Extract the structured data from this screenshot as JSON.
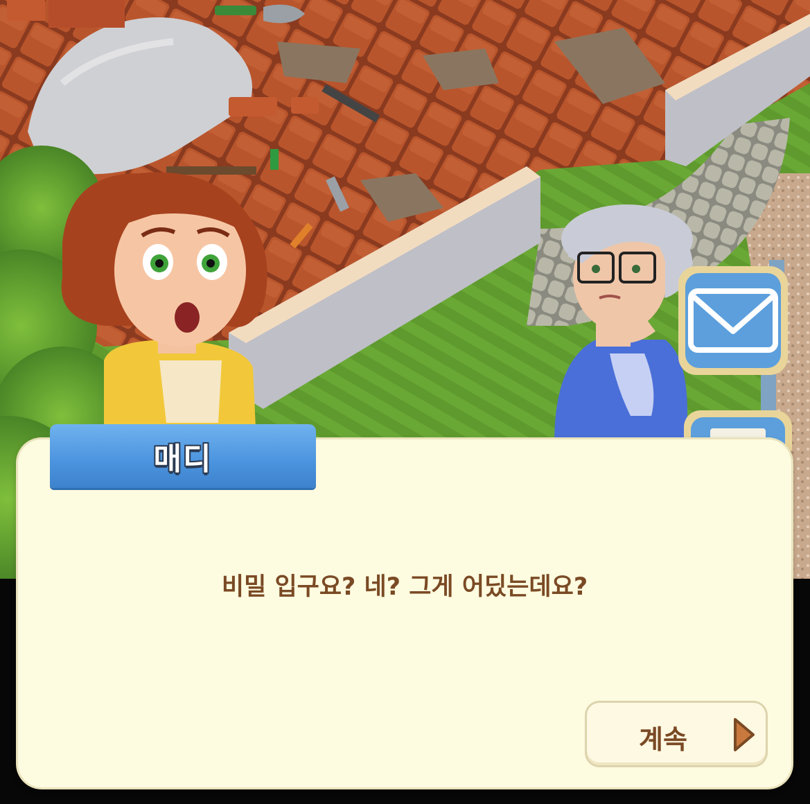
{
  "dialogue": {
    "speaker": "매디",
    "text": "비밀 입구요? 네? 그게 어딨는데요?",
    "continue_label": "계속"
  },
  "icons": {
    "mail": "mail-icon",
    "continue": "play-arrow-icon"
  },
  "colors": {
    "name_tab": "#4b93de",
    "dialog_bg": "#fdfbe0",
    "dialog_text": "#7a4a24"
  }
}
